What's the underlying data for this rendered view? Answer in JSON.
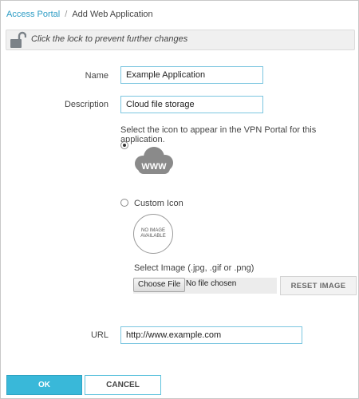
{
  "breadcrumb": {
    "root": "Access Portal",
    "separator": "/",
    "current": "Add Web Application"
  },
  "lockbar": {
    "icon": "unlocked-padlock-icon",
    "text": "Click the lock to prevent further changes"
  },
  "form": {
    "name_label": "Name",
    "name_value": "Example Application",
    "description_label": "Description",
    "description_value": "Cloud file storage",
    "icon_hint": "Select the icon to appear in the VPN Portal for this application.",
    "default_icon": {
      "name": "www-cloud-icon",
      "text": "WWW",
      "selected": true
    },
    "custom_icon": {
      "label": "Custom Icon",
      "selected": false,
      "placeholder_line1": "NO IMAGE",
      "placeholder_line2": "AVAILABLE"
    },
    "select_image_label": "Select Image (.jpg, .gif or .png)",
    "choose_file_label": "Choose File",
    "file_status": "No file chosen",
    "reset_image_label": "RESET IMAGE",
    "url_label": "URL",
    "url_value": "http://www.example.com"
  },
  "footer": {
    "ok_label": "OK",
    "cancel_label": "CANCEL"
  },
  "colors": {
    "accent": "#39b8d9",
    "link": "#2a9bc4",
    "input_border": "#7cc6e0",
    "lock_icon": "#7b8288",
    "cloud_icon": "#8a8a8a"
  }
}
